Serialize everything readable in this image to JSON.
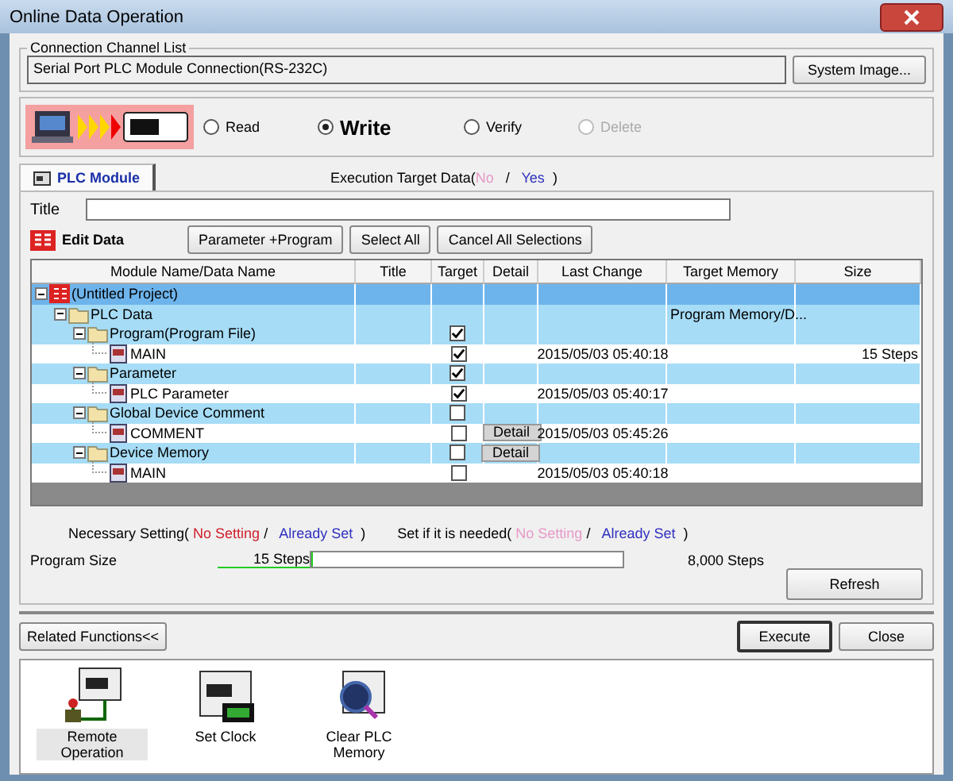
{
  "window": {
    "title": "Online Data Operation"
  },
  "connection": {
    "legend": "Connection Channel List",
    "value": "Serial Port  PLC Module Connection(RS-232C)",
    "button": "System Image..."
  },
  "modes": [
    {
      "label": "Read",
      "selected": false,
      "disabled": false
    },
    {
      "label": "Write",
      "selected": true,
      "disabled": false
    },
    {
      "label": "Verify",
      "selected": false,
      "disabled": false
    },
    {
      "label": "Delete",
      "selected": false,
      "disabled": true
    }
  ],
  "tabs": [
    {
      "label": "PLC Module",
      "selected": true
    }
  ],
  "execution_target": {
    "label": "Execution Target Data(",
    "no": "No",
    "slash": "/",
    "yes": "Yes",
    "close": ")"
  },
  "title_field": {
    "label": "Title"
  },
  "edit_data": {
    "label": "Edit Data",
    "buttons": [
      "Parameter +Program",
      "Select All",
      "Cancel All Selections"
    ]
  },
  "table": {
    "columns": [
      "Module Name/Data Name",
      "Title",
      "Target",
      "Detail",
      "Last Change",
      "Target Memory",
      "Size"
    ],
    "rows": [
      {
        "name": "(Untitled Project)",
        "kind": "group",
        "expanded": true,
        "children": [
          {
            "name": "PLC Data",
            "kind": "group",
            "expanded": true,
            "target_memory": "Program Memory/D...",
            "children": [
              {
                "name": "Program(Program File)",
                "kind": "group",
                "expanded": true,
                "checked": true,
                "children": [
                  {
                    "name": "MAIN",
                    "kind": "item",
                    "checked": true,
                    "last_change": "2015/05/03 05:40:18",
                    "size": "15 Steps"
                  }
                ]
              },
              {
                "name": "Parameter",
                "kind": "group",
                "expanded": true,
                "checked": true,
                "children": [
                  {
                    "name": "PLC Parameter",
                    "kind": "item",
                    "checked": true,
                    "last_change": "2015/05/03 05:40:17"
                  }
                ]
              },
              {
                "name": "Global Device Comment",
                "kind": "group",
                "expanded": true,
                "checked": false,
                "children": [
                  {
                    "name": "COMMENT",
                    "kind": "item",
                    "checked": false,
                    "detail": "Detail",
                    "last_change": "2015/05/03 05:45:26"
                  }
                ]
              },
              {
                "name": "Device Memory",
                "kind": "group",
                "expanded": true,
                "checked": false,
                "detail": "Detail",
                "children": [
                  {
                    "name": "MAIN",
                    "kind": "item",
                    "checked": false,
                    "last_change": "2015/05/03 05:40:18"
                  }
                ]
              }
            ]
          }
        ]
      }
    ]
  },
  "legend": [
    {
      "label": "Necessary Setting(",
      "no_setting": "No Setting",
      "slash": "/",
      "already_set": "Already Set",
      "close": ")",
      "kind": "necessary"
    },
    {
      "label": "Set if it is needed(",
      "no_setting": "No Setting",
      "slash": "/",
      "already_set": "Already Set",
      "close": ")",
      "kind": "optional"
    }
  ],
  "program_size": {
    "label": "Program Size",
    "used": "15 Steps",
    "level": 0.002,
    "capacity": "8,000 Steps"
  },
  "refresh": "Refresh",
  "related": "Related Functions<<",
  "actions": [
    {
      "label": "Execute",
      "focused": true
    },
    {
      "label": "Close",
      "focused": false
    }
  ],
  "functions": [
    {
      "label": "Remote Operation",
      "kind": "remote",
      "selected": true
    },
    {
      "label": "Set Clock",
      "kind": "clock",
      "selected": false
    },
    {
      "label": "Clear PLC Memory",
      "kind": "clear",
      "selected": false
    }
  ]
}
